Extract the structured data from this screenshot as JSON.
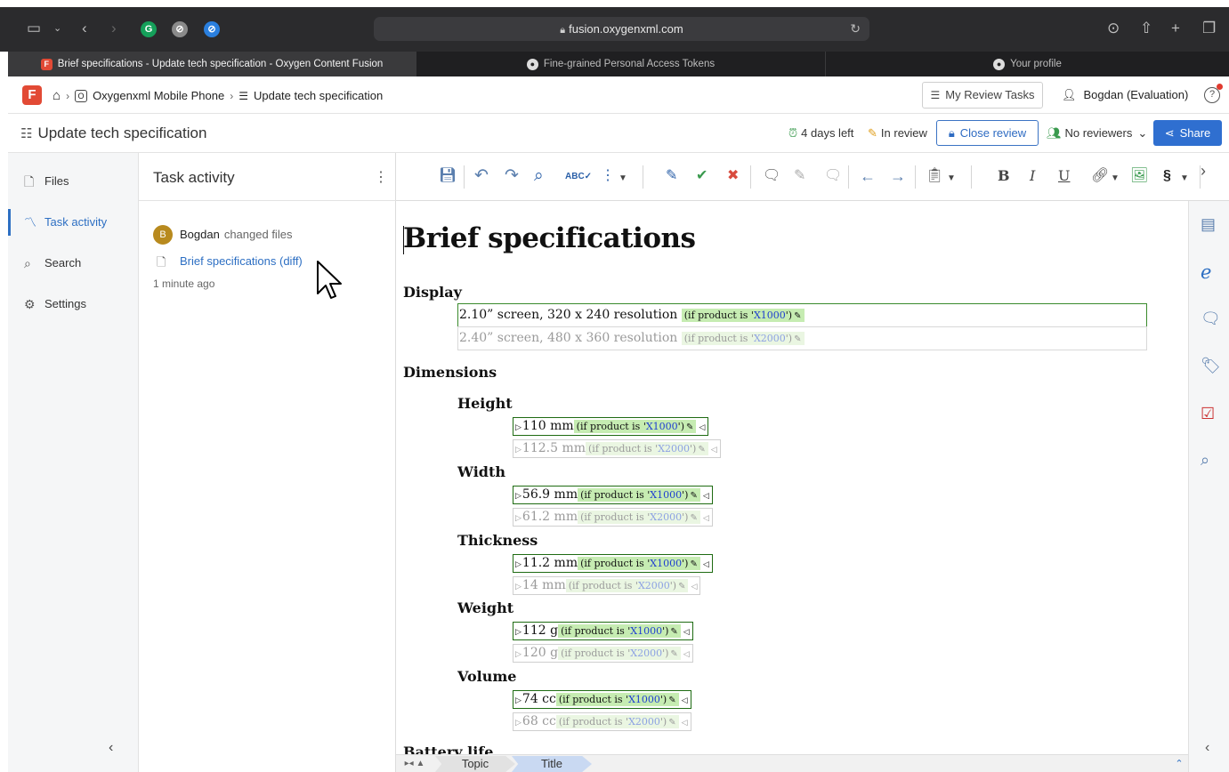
{
  "browser": {
    "url": "fusion.oxygenxml.com",
    "tabs": [
      {
        "label": "Brief specifications - Update tech specification - Oxygen Content Fusion",
        "active": true
      },
      {
        "label": "Fine-grained Personal Access Tokens",
        "active": false
      },
      {
        "label": "Your profile",
        "active": false
      }
    ]
  },
  "app": {
    "breadcrumb": {
      "project": "Oxygenxml Mobile Phone",
      "task": "Update tech specification"
    },
    "review_tasks_label": "My Review Tasks",
    "user_label": "Bogdan  (Evaluation)"
  },
  "task": {
    "title": "Update tech specification",
    "time_left": "4 days left",
    "status": "In review",
    "close_review_label": "Close review",
    "reviewers_label": "No reviewers",
    "share_label": "Share"
  },
  "nav": {
    "items": [
      {
        "label": "Files",
        "icon": "file-icon"
      },
      {
        "label": "Task activity",
        "icon": "activity-icon",
        "active": true
      },
      {
        "label": "Search",
        "icon": "search-icon"
      },
      {
        "label": "Settings",
        "icon": "gear-icon"
      }
    ]
  },
  "activity": {
    "header": "Task activity",
    "avatar_letter": "B",
    "actor": "Bogdan",
    "action": "changed files",
    "file_link": "Brief specifications (diff)",
    "time_ago": "1 minute ago"
  },
  "document": {
    "title": "Brief specifications",
    "display_heading": "Display",
    "display_on": {
      "text": "2.10” screen, 320 x 240 resolution",
      "cond_prefix": "(if product is '",
      "cond_value": "X1000",
      "cond_suffix": "')"
    },
    "display_off": {
      "text": "2.40” screen, 480 x 360 resolution",
      "cond_prefix": "(if product is '",
      "cond_value": "X2000",
      "cond_suffix": "')"
    },
    "dimensions_heading": "Dimensions",
    "height_label": "Height",
    "height_on": "110 mm",
    "height_off": "112.5 mm",
    "width_label": "Width",
    "width_on": "56.9 mm",
    "width_off": "61.2 mm",
    "thickness_label": "Thickness",
    "thickness_on": "11.2 mm",
    "thickness_off": "14 mm",
    "weight_label": "Weight",
    "weight_on": "112 g",
    "weight_off": "120 g",
    "volume_label": "Volume",
    "volume_on": "74 cc",
    "volume_off": "68 cc",
    "next_heading": "Battery life",
    "cond_prefix": "(if product is '",
    "cond_on_value": "X1000",
    "cond_off_value": "X2000",
    "cond_suffix": "')"
  },
  "bottom": {
    "crumb1": "Topic",
    "crumb2": "Title"
  },
  "colors": {
    "accent": "#2f6fd0",
    "oxygen": "#e24a35",
    "cond_bg": "#c6ecb2"
  }
}
